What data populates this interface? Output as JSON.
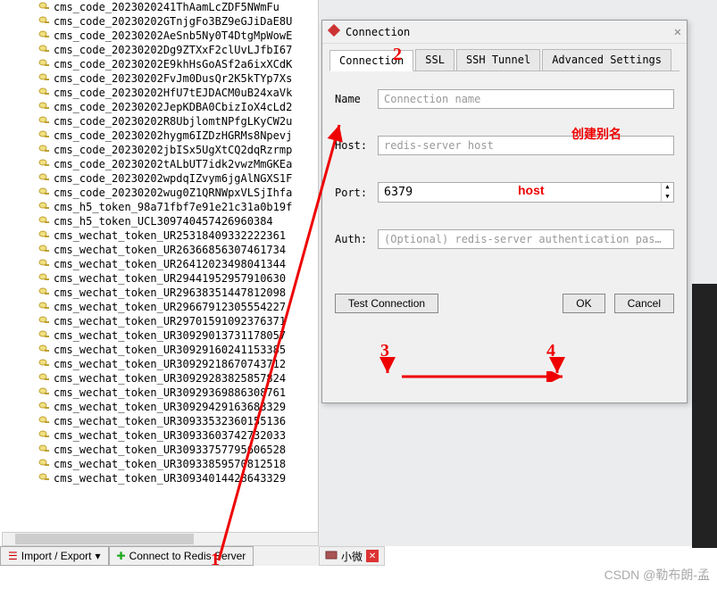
{
  "tree": {
    "items": [
      "cms_code_2023020241ThAamLcZDF5NWmFu",
      "cms_code_20230202GTnjgFo3BZ9eGJiDaE8U",
      "cms_code_20230202AeSnb5Ny0T4DtgMpWowE",
      "cms_code_20230202Dg9ZTXxF2clUvLJfbI67",
      "cms_code_20230202E9khHsGoASf2a6ixXCdK",
      "cms_code_20230202FvJm0DusQr2K5kTYp7Xs",
      "cms_code_20230202HfU7tEJDACM0uB24xaVk",
      "cms_code_20230202JepKDBA0CbizIoX4cLd2",
      "cms_code_20230202R8UbjlomtNPfgLKyCW2u",
      "cms_code_20230202hygm6IZDzHGRMs8Npevj",
      "cms_code_20230202jbISx5UgXtCQ2dqRzrmp",
      "cms_code_20230202tALbUT7idk2vwzMmGKEa",
      "cms_code_20230202wpdqIZvym6jgAlNGXS1F",
      "cms_code_20230202wug0Z1QRNWpxVLSjIhfa",
      "cms_h5_token_98a71fbf7e91e21c31a0b19f",
      "cms_h5_token_UCL309740457426960384",
      "cms_wechat_token_UR25318409332222361",
      "cms_wechat_token_UR26366856307461734",
      "cms_wechat_token_UR26412023498041344",
      "cms_wechat_token_UR29441952957910630",
      "cms_wechat_token_UR29638351447812098",
      "cms_wechat_token_UR29667912305554227",
      "cms_wechat_token_UR29701591092376371",
      "cms_wechat_token_UR30929013731178057",
      "cms_wechat_token_UR30929160241153385",
      "cms_wechat_token_UR30929218670743712",
      "cms_wechat_token_UR30929283825857824",
      "cms_wechat_token_UR30929369886308761",
      "cms_wechat_token_UR30929429163683329",
      "cms_wechat_token_UR30933532360155136",
      "cms_wechat_token_UR30933603742732033",
      "cms_wechat_token_UR30933757795606528",
      "cms_wechat_token_UR30933859570812518",
      "cms_wechat_token_UR30934014428643329"
    ]
  },
  "bottom": {
    "import_export": "Import / Export",
    "connect": "Connect to Redis Server"
  },
  "status": {
    "label": "小微"
  },
  "dialog": {
    "title": "Connection",
    "tabs": {
      "connection": "Connection",
      "ssl": "SSL",
      "ssh": "SSH Tunnel",
      "advanced": "Advanced Settings"
    },
    "form": {
      "name_label": "Name",
      "name_placeholder": "Connection name",
      "host_label": "Host:",
      "host_placeholder": "redis-server host",
      "port_label": "Port:",
      "port_value": "6379",
      "auth_label": "Auth:",
      "auth_placeholder": "(Optional) redis-server authentication pas…"
    },
    "buttons": {
      "test": "Test Connection",
      "ok": "OK",
      "cancel": "Cancel"
    }
  },
  "annotations": {
    "n1": "1",
    "n2": "2",
    "n3": "3",
    "n4": "4",
    "alias": "创建别名",
    "host": "host"
  },
  "watermark": "CSDN @勒布朗-孟"
}
